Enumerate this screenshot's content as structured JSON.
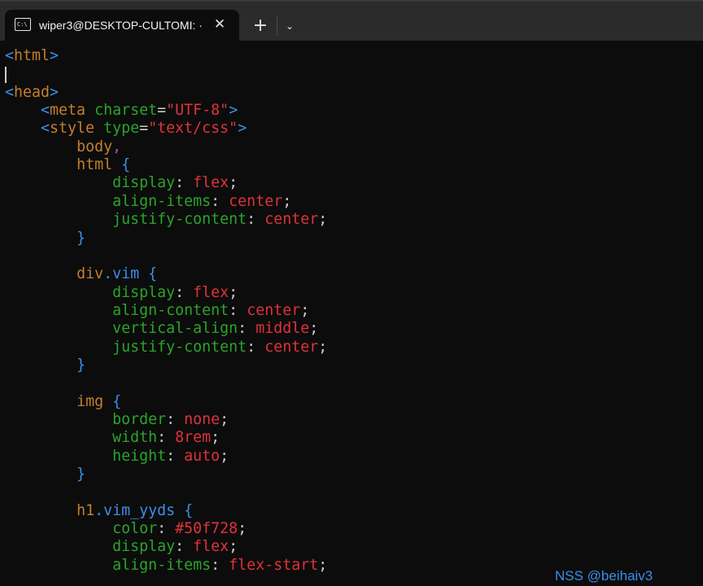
{
  "window": {
    "tab_title": "wiper3@DESKTOP-CULTOMI: ·",
    "tab_icon": "terminal-icon",
    "close_glyph": "✕",
    "new_tab_glyph": "+",
    "dropdown_glyph": "⌄"
  },
  "code_lines": [
    [
      {
        "t": "<",
        "c": "bracket"
      },
      {
        "t": "html",
        "c": "tag"
      },
      {
        "t": ">",
        "c": "bracket"
      }
    ],
    [],
    [
      {
        "t": "<",
        "c": "bracket"
      },
      {
        "t": "head",
        "c": "tag"
      },
      {
        "t": ">",
        "c": "bracket"
      }
    ],
    [
      {
        "t": "    <",
        "c": "bracket"
      },
      {
        "t": "meta",
        "c": "tag"
      },
      {
        "t": " ",
        "c": "punc"
      },
      {
        "t": "charset",
        "c": "attr"
      },
      {
        "t": "=",
        "c": "punc"
      },
      {
        "t": "\"UTF-8\"",
        "c": "str"
      },
      {
        "t": ">",
        "c": "bracket"
      }
    ],
    [
      {
        "t": "    <",
        "c": "bracket"
      },
      {
        "t": "style",
        "c": "tag"
      },
      {
        "t": " ",
        "c": "punc"
      },
      {
        "t": "type",
        "c": "attr"
      },
      {
        "t": "=",
        "c": "punc"
      },
      {
        "t": "\"text/css\"",
        "c": "str"
      },
      {
        "t": ">",
        "c": "bracket"
      }
    ],
    [
      {
        "t": "        ",
        "c": "punc"
      },
      {
        "t": "body",
        "c": "sel"
      },
      {
        "t": ",",
        "c": "comma"
      }
    ],
    [
      {
        "t": "        ",
        "c": "punc"
      },
      {
        "t": "html",
        "c": "sel"
      },
      {
        "t": " {",
        "c": "brace"
      }
    ],
    [
      {
        "t": "            ",
        "c": "punc"
      },
      {
        "t": "display",
        "c": "prop"
      },
      {
        "t": ": ",
        "c": "punc"
      },
      {
        "t": "flex",
        "c": "val"
      },
      {
        "t": ";",
        "c": "punc"
      }
    ],
    [
      {
        "t": "            ",
        "c": "punc"
      },
      {
        "t": "align-items",
        "c": "prop"
      },
      {
        "t": ": ",
        "c": "punc"
      },
      {
        "t": "center",
        "c": "val"
      },
      {
        "t": ";",
        "c": "punc"
      }
    ],
    [
      {
        "t": "            ",
        "c": "punc"
      },
      {
        "t": "justify-content",
        "c": "prop"
      },
      {
        "t": ": ",
        "c": "punc"
      },
      {
        "t": "center",
        "c": "val"
      },
      {
        "t": ";",
        "c": "punc"
      }
    ],
    [
      {
        "t": "        }",
        "c": "brace"
      }
    ],
    [],
    [
      {
        "t": "        ",
        "c": "punc"
      },
      {
        "t": "div",
        "c": "sel"
      },
      {
        "t": ".vim",
        "c": "cls"
      },
      {
        "t": " {",
        "c": "brace"
      }
    ],
    [
      {
        "t": "            ",
        "c": "punc"
      },
      {
        "t": "display",
        "c": "prop"
      },
      {
        "t": ": ",
        "c": "punc"
      },
      {
        "t": "flex",
        "c": "val"
      },
      {
        "t": ";",
        "c": "punc"
      }
    ],
    [
      {
        "t": "            ",
        "c": "punc"
      },
      {
        "t": "align-content",
        "c": "prop"
      },
      {
        "t": ": ",
        "c": "punc"
      },
      {
        "t": "center",
        "c": "val"
      },
      {
        "t": ";",
        "c": "punc"
      }
    ],
    [
      {
        "t": "            ",
        "c": "punc"
      },
      {
        "t": "vertical-align",
        "c": "prop"
      },
      {
        "t": ": ",
        "c": "punc"
      },
      {
        "t": "middle",
        "c": "val"
      },
      {
        "t": ";",
        "c": "punc"
      }
    ],
    [
      {
        "t": "            ",
        "c": "punc"
      },
      {
        "t": "justify-content",
        "c": "prop"
      },
      {
        "t": ": ",
        "c": "punc"
      },
      {
        "t": "center",
        "c": "val"
      },
      {
        "t": ";",
        "c": "punc"
      }
    ],
    [
      {
        "t": "        }",
        "c": "brace"
      }
    ],
    [],
    [
      {
        "t": "        ",
        "c": "punc"
      },
      {
        "t": "img",
        "c": "sel"
      },
      {
        "t": " {",
        "c": "brace"
      }
    ],
    [
      {
        "t": "            ",
        "c": "punc"
      },
      {
        "t": "border",
        "c": "prop"
      },
      {
        "t": ": ",
        "c": "punc"
      },
      {
        "t": "none",
        "c": "val"
      },
      {
        "t": ";",
        "c": "punc"
      }
    ],
    [
      {
        "t": "            ",
        "c": "punc"
      },
      {
        "t": "width",
        "c": "prop"
      },
      {
        "t": ": ",
        "c": "punc"
      },
      {
        "t": "8rem",
        "c": "val"
      },
      {
        "t": ";",
        "c": "punc"
      }
    ],
    [
      {
        "t": "            ",
        "c": "punc"
      },
      {
        "t": "height",
        "c": "prop"
      },
      {
        "t": ": ",
        "c": "punc"
      },
      {
        "t": "auto",
        "c": "val"
      },
      {
        "t": ";",
        "c": "punc"
      }
    ],
    [
      {
        "t": "        }",
        "c": "brace"
      }
    ],
    [],
    [
      {
        "t": "        ",
        "c": "punc"
      },
      {
        "t": "h1",
        "c": "sel"
      },
      {
        "t": ".vim_yyds",
        "c": "cls"
      },
      {
        "t": " {",
        "c": "brace"
      }
    ],
    [
      {
        "t": "            ",
        "c": "punc"
      },
      {
        "t": "color",
        "c": "prop"
      },
      {
        "t": ": ",
        "c": "punc"
      },
      {
        "t": "#50f728",
        "c": "val"
      },
      {
        "t": ";",
        "c": "punc"
      }
    ],
    [
      {
        "t": "            ",
        "c": "punc"
      },
      {
        "t": "display",
        "c": "prop"
      },
      {
        "t": ": ",
        "c": "punc"
      },
      {
        "t": "flex",
        "c": "val"
      },
      {
        "t": ";",
        "c": "punc"
      }
    ],
    [
      {
        "t": "            ",
        "c": "punc"
      },
      {
        "t": "align-items",
        "c": "prop"
      },
      {
        "t": ": ",
        "c": "punc"
      },
      {
        "t": "flex-start",
        "c": "val"
      },
      {
        "t": ";",
        "c": "punc"
      }
    ]
  ],
  "watermark": "NSS @beihaiv3",
  "colors": {
    "background": "#0c0c0c",
    "titlebar": "#2b2b2b",
    "tag": "#c47f2c",
    "bracket": "#3b8eea",
    "attribute": "#2aa52a",
    "string": "#e0323a"
  }
}
